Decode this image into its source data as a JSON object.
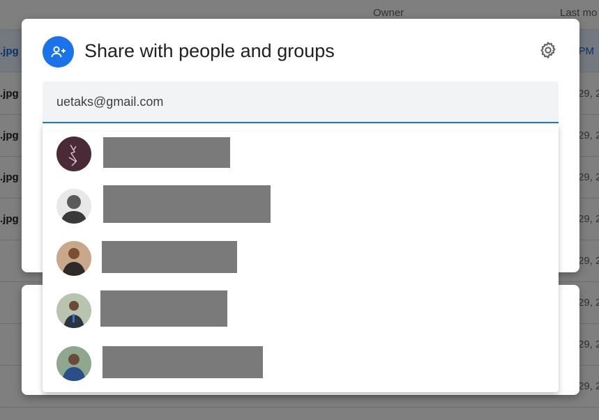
{
  "background": {
    "columns": {
      "owner": "Owner",
      "last_modified": "Last mo"
    },
    "rows": [
      {
        "file": ".jpg",
        "modified": "3 PM",
        "selected": true
      },
      {
        "file": ".jpg",
        "modified": "29, 2",
        "selected": false
      },
      {
        "file": ".jpg",
        "modified": "29, 2",
        "selected": false
      },
      {
        "file": ".jpg",
        "modified": "29, 2",
        "selected": false
      },
      {
        "file": ".jpg",
        "modified": "29, 2",
        "selected": false
      },
      {
        "file": "",
        "modified": "29, 2",
        "selected": false
      },
      {
        "file": "",
        "modified": "29, 2",
        "selected": false
      },
      {
        "file": "",
        "modified": "29, 2",
        "selected": false
      },
      {
        "file": "",
        "modified": "29, 2",
        "selected": false
      }
    ]
  },
  "dialog": {
    "title": "Share with people and groups",
    "title_icon": "person-add-icon",
    "settings_icon": "gear-icon",
    "input": {
      "value": "uetaks@gmail.com",
      "placeholder": ""
    }
  },
  "suggestions": [
    {
      "avatar": "contact-avatar-1",
      "name": ""
    },
    {
      "avatar": "contact-avatar-2",
      "name": ""
    },
    {
      "avatar": "contact-avatar-3",
      "name": ""
    },
    {
      "avatar": "contact-avatar-4",
      "name": ""
    },
    {
      "avatar": "contact-avatar-5",
      "name": ""
    }
  ],
  "colors": {
    "accent": "#1a73e8",
    "redaction": "#7a7a7a",
    "scrim": "rgba(0,0,0,0.5)"
  }
}
